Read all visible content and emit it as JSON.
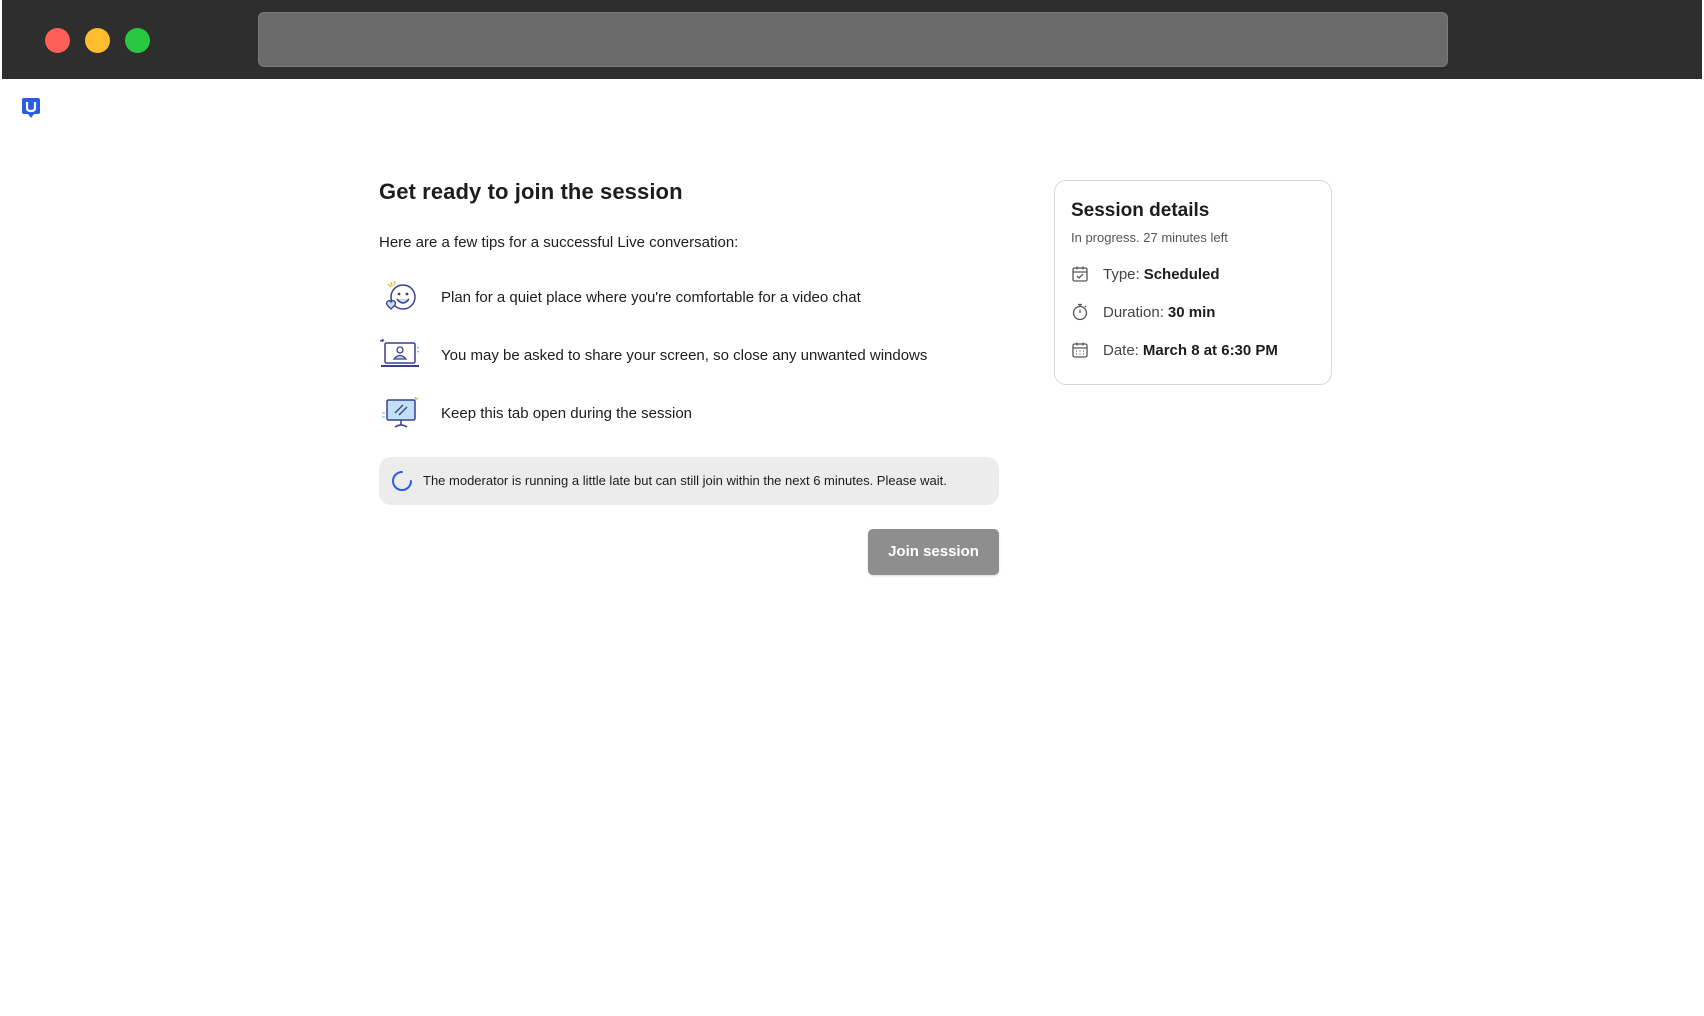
{
  "main": {
    "heading": "Get ready to join the session",
    "intro": "Here are a few tips for a successful Live conversation:",
    "tips": [
      {
        "icon": "happy-face-icon",
        "text": "Plan for a quiet place where you're comfortable for a video chat"
      },
      {
        "icon": "laptop-user-icon",
        "text": "You may be asked to share your screen, so close any unwanted windows"
      },
      {
        "icon": "monitor-icon",
        "text": "Keep this tab open during the session"
      }
    ],
    "notice": "The moderator is running a little late but can still join within the next 6 minutes. Please wait.",
    "join_label": "Join session"
  },
  "details": {
    "title": "Session details",
    "status": "In progress. 27 minutes left",
    "type_label": "Type:",
    "type_value": "Scheduled",
    "duration_label": "Duration:",
    "duration_value": "30 min",
    "date_label": "Date:",
    "date_value": "March 8 at 6:30 PM"
  },
  "colors": {
    "brand": "#2b5ce6",
    "button_disabled": "#8e8e8e",
    "notice_bg": "#ececec"
  }
}
